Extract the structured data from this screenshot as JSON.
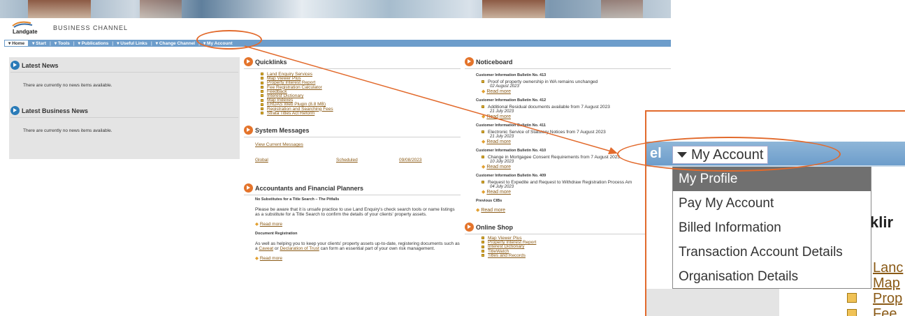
{
  "header": {
    "logo_text": "Landgate",
    "channel": "BUSINESS CHANNEL"
  },
  "nav": [
    {
      "label": "Home"
    },
    {
      "label": "Start"
    },
    {
      "label": "Tools"
    },
    {
      "label": "Publications"
    },
    {
      "label": "Useful Links"
    },
    {
      "label": "Change Channel"
    },
    {
      "label": "My Account"
    }
  ],
  "latest_news": {
    "title": "Latest News",
    "empty": "There are currently no news items available."
  },
  "latest_business_news": {
    "title": "Latest Business News",
    "empty": "There are currently no news items available."
  },
  "quicklinks": {
    "title": "Quicklinks",
    "items": [
      "Land Enquiry Services",
      "Map Viewer Plus",
      "Property Interest Report",
      "Fee Registration Calculator",
      "Feedback",
      "Interest Dictionary",
      "Map Indexes",
      "ERDAS Web Plugin (8.8 MB)",
      "Registration and Searching Fees",
      "Strata Titles Act Reform"
    ]
  },
  "system_messages": {
    "title": "System Messages",
    "view_link": "View Current Messages",
    "row": {
      "name": "Global",
      "status": "Scheduled",
      "date": "09/08/2023"
    }
  },
  "accountants": {
    "title": "Accountants and Financial Planners",
    "h1": "No Substitutes for a Title Search – The Pitfalls",
    "p1": "Please be aware that it is unsafe practice to use Land Enquiry's check search tools or name listings as a substitute for a Title Search to confirm the details of your clients' property assets.",
    "read1": "Read more",
    "h2": "Document Registration",
    "p2_a": "As well as helping you to keep your clients' property assets up-to-date, registering documents such as a ",
    "p2_link1": "Caveat",
    "p2_b": " or ",
    "p2_link2": "Declaration of Trust",
    "p2_c": " can form an essential part of your own risk management.",
    "read2": "Read more"
  },
  "noticeboard": {
    "title": "Noticeboard",
    "read_more": "Read more",
    "items": [
      {
        "cib": "Customer Information Bulletin No. 413",
        "text": "Proof of property ownership in WA remains unchanged",
        "date": "02 August 2023"
      },
      {
        "cib": "Customer Information Bulletin No. 412",
        "text": "Additional Residual documents available from 7 August 2023",
        "date": "21 July 2023"
      },
      {
        "cib": "Customer Information Bulletin No. 411",
        "text": "Electronic Service of Statutory Notices from 7 August 2023",
        "date": "21 July 2023"
      },
      {
        "cib": "Customer Information Bulletin No. 410",
        "text": "Change in Mortgagee Consent Requirements from 7 August 2023",
        "date": "10 July 2023"
      },
      {
        "cib": "Customer Information Bulletin No. 409",
        "text": "Request to Expedite and Request to Withdraw Registration Process Am",
        "date": "04 July 2023"
      }
    ],
    "previous": "Previous CIBs"
  },
  "online_shop": {
    "title": "Online Shop",
    "items": [
      "Map Viewer Plus",
      "Property Interest Report",
      "Interest Dictionary",
      "TitleWatch",
      "Titles and Records"
    ]
  },
  "zoom": {
    "nav_partial": "el",
    "account": "My Account",
    "menu": [
      "My Profile",
      "Pay My Account",
      "Billed Information",
      "Transaction Account Details",
      "Organisation Details"
    ],
    "partial_heading": "klir",
    "partial_links": [
      "Lanc",
      "Map",
      "Prop",
      "Fee"
    ]
  }
}
